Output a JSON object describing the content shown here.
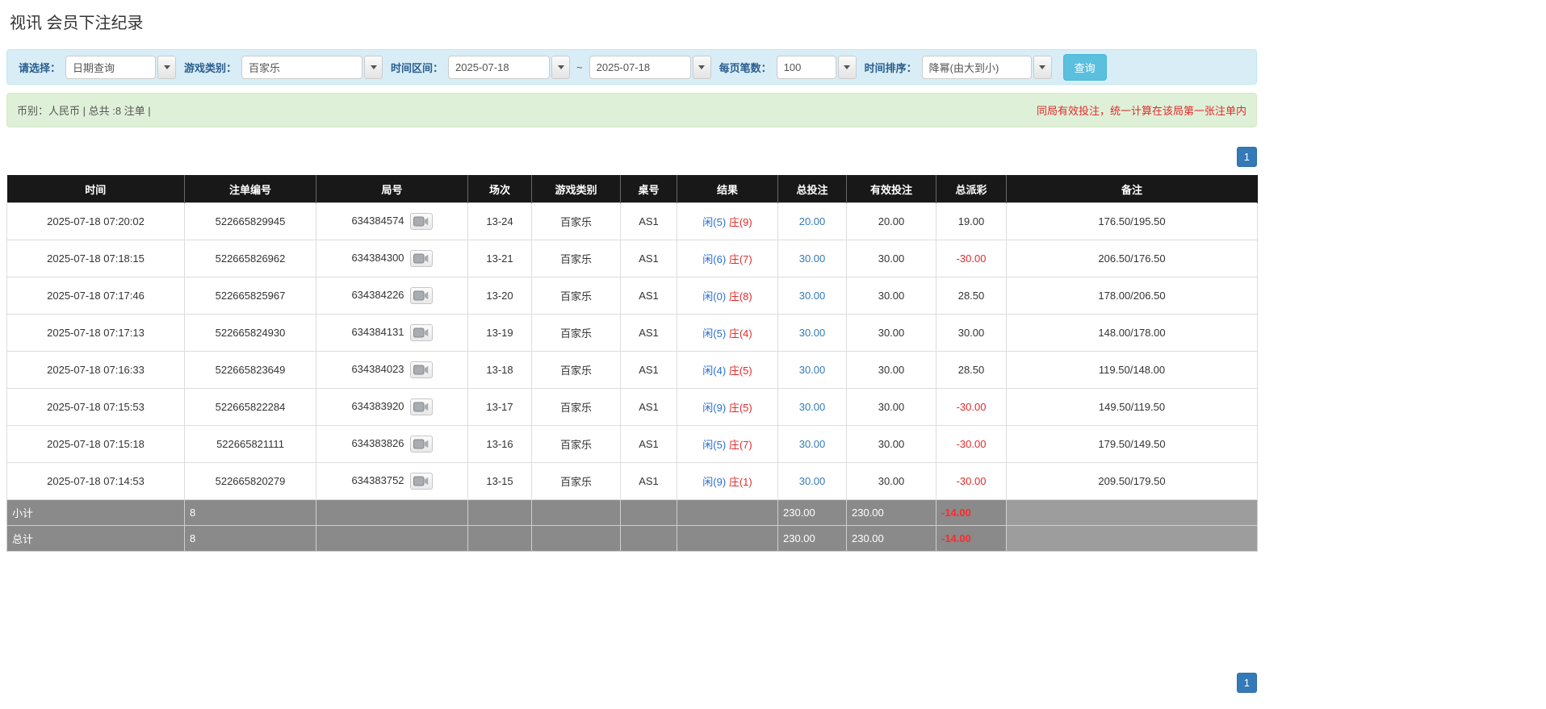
{
  "page": {
    "title": "视讯 会员下注纪录"
  },
  "colors": {
    "filter_label": "#2a5e8c",
    "search_btn": "#5bc0de",
    "pager_blue": "#337ab7",
    "link_blue": "#337ab7",
    "player_blue": "#2a6fd1",
    "banker_red": "#e12b2b",
    "negative_red": "#e12b2b"
  },
  "filters": {
    "select_label": "请选择：",
    "select_value": "日期查询",
    "game_type_label": "游戏类别：",
    "game_type_value": "百家乐",
    "time_range_label": "时间区间：",
    "date_from": "2025-07-18",
    "tilde": "~",
    "date_to": "2025-07-18",
    "page_size_label": "每页笔数：",
    "page_size_value": "100",
    "sort_label": "时间排序：",
    "sort_value": "降幂(由大到小)",
    "search_button": "查询"
  },
  "summary": {
    "left": "币别：人民币 | 总共 :8 注单 |",
    "right": "同局有效投注，统一计算在该局第一张注单内"
  },
  "pagination": {
    "page": "1"
  },
  "table": {
    "headers": [
      "时间",
      "注单编号",
      "局号",
      "场次",
      "游戏类别",
      "桌号",
      "结果",
      "总投注",
      "有效投注",
      "总派彩",
      "备注"
    ],
    "rows": [
      {
        "time": "2025-07-18 07:20:02",
        "bet_id": "522665829945",
        "round_id": "634384574",
        "session": "13-24",
        "game": "百家乐",
        "table_no": "AS1",
        "result_player": "闲(5)",
        "result_banker": "庄(9)",
        "total_bet": "20.00",
        "valid_bet": "20.00",
        "payout": "19.00",
        "remark": "176.50/195.50"
      },
      {
        "time": "2025-07-18 07:18:15",
        "bet_id": "522665826962",
        "round_id": "634384300",
        "session": "13-21",
        "game": "百家乐",
        "table_no": "AS1",
        "result_player": "闲(6)",
        "result_banker": "庄(7)",
        "total_bet": "30.00",
        "valid_bet": "30.00",
        "payout": "-30.00",
        "remark": "206.50/176.50"
      },
      {
        "time": "2025-07-18 07:17:46",
        "bet_id": "522665825967",
        "round_id": "634384226",
        "session": "13-20",
        "game": "百家乐",
        "table_no": "AS1",
        "result_player": "闲(0)",
        "result_banker": "庄(8)",
        "total_bet": "30.00",
        "valid_bet": "30.00",
        "payout": "28.50",
        "remark": "178.00/206.50"
      },
      {
        "time": "2025-07-18 07:17:13",
        "bet_id": "522665824930",
        "round_id": "634384131",
        "session": "13-19",
        "game": "百家乐",
        "table_no": "AS1",
        "result_player": "闲(5)",
        "result_banker": "庄(4)",
        "total_bet": "30.00",
        "valid_bet": "30.00",
        "payout": "30.00",
        "remark": "148.00/178.00"
      },
      {
        "time": "2025-07-18 07:16:33",
        "bet_id": "522665823649",
        "round_id": "634384023",
        "session": "13-18",
        "game": "百家乐",
        "table_no": "AS1",
        "result_player": "闲(4)",
        "result_banker": "庄(5)",
        "total_bet": "30.00",
        "valid_bet": "30.00",
        "payout": "28.50",
        "remark": "119.50/148.00"
      },
      {
        "time": "2025-07-18 07:15:53",
        "bet_id": "522665822284",
        "round_id": "634383920",
        "session": "13-17",
        "game": "百家乐",
        "table_no": "AS1",
        "result_player": "闲(9)",
        "result_banker": "庄(5)",
        "total_bet": "30.00",
        "valid_bet": "30.00",
        "payout": "-30.00",
        "remark": "149.50/119.50"
      },
      {
        "time": "2025-07-18 07:15:18",
        "bet_id": "522665821111",
        "round_id": "634383826",
        "session": "13-16",
        "game": "百家乐",
        "table_no": "AS1",
        "result_player": "闲(5)",
        "result_banker": "庄(7)",
        "total_bet": "30.00",
        "valid_bet": "30.00",
        "payout": "-30.00",
        "remark": "179.50/149.50"
      },
      {
        "time": "2025-07-18 07:14:53",
        "bet_id": "522665820279",
        "round_id": "634383752",
        "session": "13-15",
        "game": "百家乐",
        "table_no": "AS1",
        "result_player": "闲(9)",
        "result_banker": "庄(1)",
        "total_bet": "30.00",
        "valid_bet": "30.00",
        "payout": "-30.00",
        "remark": "209.50/179.50"
      }
    ],
    "subtotal": {
      "label": "小计",
      "count": "8",
      "total_bet": "230.00",
      "valid_bet": "230.00",
      "payout": "-14.00"
    },
    "total": {
      "label": "总计",
      "count": "8",
      "total_bet": "230.00",
      "valid_bet": "230.00",
      "payout": "-14.00"
    }
  }
}
